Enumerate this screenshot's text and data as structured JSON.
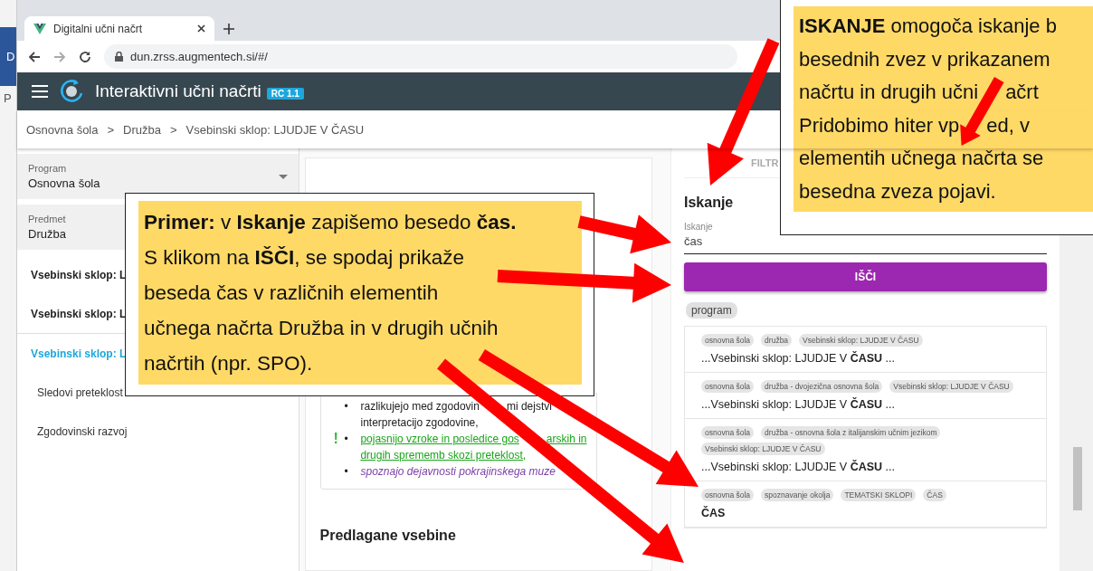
{
  "background_window": {
    "letters": [
      "D",
      "P"
    ]
  },
  "browser": {
    "tab_title": "Digitalni učni načrt",
    "url": "dun.zrss.augmentech.si/#/"
  },
  "app_bar": {
    "title": "Interaktivni učni načrti",
    "badge": "RC 1.1"
  },
  "breadcrumb": [
    "Osnovna šola",
    "Družba",
    "Vsebinski sklop: LJUDJE V ČASU"
  ],
  "breadcrumb_separator": ">",
  "sidebar": {
    "selects": [
      {
        "label": "Program",
        "value": "Osnovna šola"
      },
      {
        "label": "Predmet",
        "value": "Družba"
      }
    ],
    "items": [
      {
        "label": "Vsebinski sklop: L",
        "selected": false
      },
      {
        "label": "Vsebinski sklop: L",
        "selected": false
      },
      {
        "label": "Vsebinski sklop: L",
        "selected": true,
        "children": [
          {
            "label": "Sledovi preteklost"
          },
          {
            "label": "Zgodovinski razvoj"
          }
        ]
      }
    ]
  },
  "content": {
    "goals": [
      {
        "kind": "plain",
        "bullet": "•",
        "lines": [
          [
            "razlikujejo med zgodovin",
            "mi dejstvi"
          ],
          [
            "interpretacijo zgodovine,"
          ]
        ]
      },
      {
        "kind": "essential",
        "bullet": "•",
        "marker": "!",
        "lines": [
          [
            "pojasnijo vzroke in posledice gos",
            "arskih in"
          ],
          [
            "drugih sprememb skozi preteklost,"
          ]
        ]
      },
      {
        "kind": "optional",
        "bullet": "•",
        "lines": [
          [
            "spoznajo dejavnosti pokrajinskega muze"
          ]
        ]
      }
    ],
    "next_section_title": "Predlagane vsebine"
  },
  "search_panel": {
    "tab": "FILTR",
    "title": "Iskanje",
    "field": {
      "label": "Iskanje",
      "value": "čas"
    },
    "button": "IŠČI",
    "filter_chip": "program",
    "results": [
      {
        "chips": [
          "osnovna šola",
          "družba",
          "Vsebinski sklop: LJUDJE V ČASU"
        ],
        "snippet": "...Vsebinski sklop: LJUDJE V **ČASU** ..."
      },
      {
        "chips": [
          "osnovna šola",
          "družba - dvojezična osnovna šola",
          "Vsebinski sklop: LJUDJE V ČASU"
        ],
        "snippet": "...Vsebinski sklop: LJUDJE V **ČASU** ..."
      },
      {
        "chips": [
          "osnovna šola",
          "družba - osnovna šola z italijanskim učnim jezikom",
          "Vsebinski sklop: LJUDJE V ČASU"
        ],
        "snippet": "...Vsebinski sklop: LJUDJE V **ČASU** ..."
      },
      {
        "chips": [
          "osnovna šola",
          "spoznavanje okolja",
          "TEMATSKI SKLOPI",
          "ČAS"
        ],
        "snippet": "**ČAS**"
      }
    ]
  },
  "callouts": [
    {
      "kind": "example",
      "lines": [
        [
          "**Primer:** v **Iskanje** zapišemo besedo **čas.**"
        ],
        [
          "S klikom na **IŠČI**, se spodaj prikaže"
        ],
        [
          "beseda čas v različnih elementih"
        ],
        [
          "učnega načrta Družba in v drugih učnih"
        ],
        [
          "načrtih (npr. SPO)."
        ]
      ]
    },
    {
      "kind": "info",
      "lines": [
        [
          "**ISKANJE** omogoča iskanje b"
        ],
        [
          "besednih zvez v prikazanem"
        ],
        [
          "načrtu in drugih učni",
          "ačrt"
        ],
        [
          "Pridobimo hiter vp",
          "ed, v"
        ],
        [
          "elementih učnega načrta se"
        ],
        [
          "besedna zveza pojavi."
        ]
      ]
    }
  ]
}
